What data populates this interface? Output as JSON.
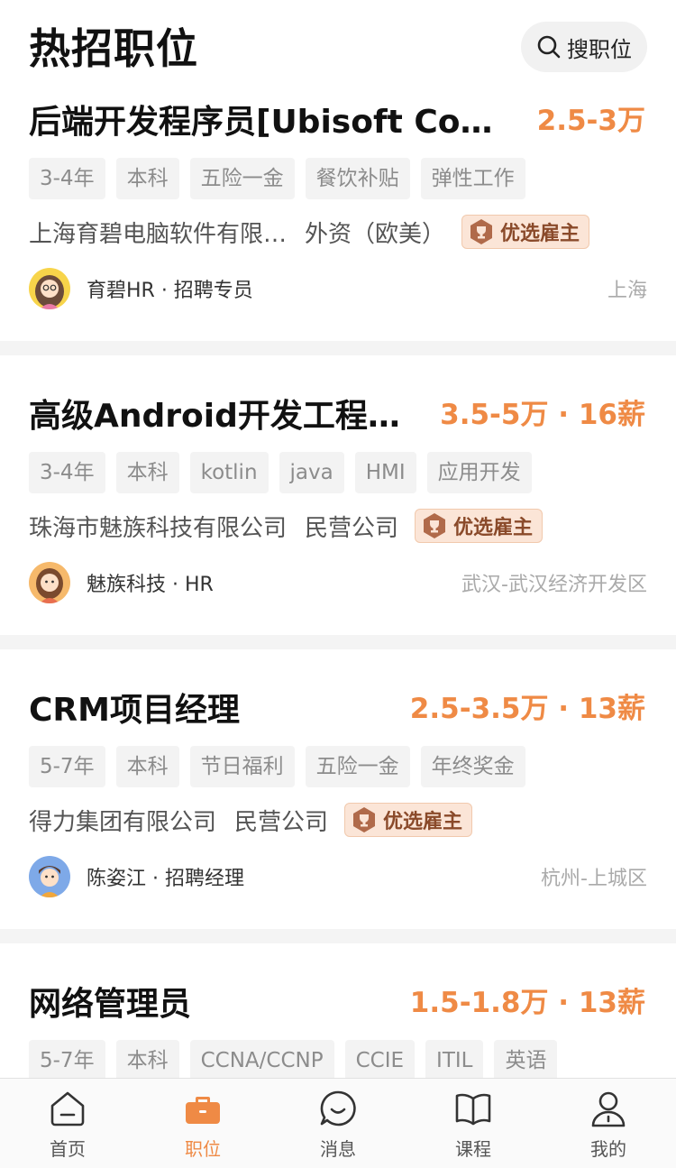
{
  "header": {
    "title": "热招职位",
    "search_label": "搜职位"
  },
  "jobs": [
    {
      "title": "后端开发程序员[Ubisoft Conn…",
      "salary": "2.5-3万",
      "tags": [
        "3-4年",
        "本科",
        "五险一金",
        "餐饮补贴",
        "弹性工作"
      ],
      "company": "上海育碧电脑软件有限…",
      "company_type": "外资（欧美）",
      "badge": "优选雇主",
      "hr": "育碧HR · 招聘专员",
      "location": "上海"
    },
    {
      "title": "高级Android开发工程师…",
      "salary": "3.5-5万 · 16薪",
      "tags": [
        "3-4年",
        "本科",
        "kotlin",
        "java",
        "HMI",
        "应用开发"
      ],
      "company": "珠海市魅族科技有限公司",
      "company_type": "民营公司",
      "badge": "优选雇主",
      "hr": "魅族科技 · HR",
      "location": "武汉-武汉经济开发区"
    },
    {
      "title": "CRM项目经理",
      "salary": "2.5-3.5万 · 13薪",
      "tags": [
        "5-7年",
        "本科",
        "节日福利",
        "五险一金",
        "年终奖金"
      ],
      "company": "得力集团有限公司",
      "company_type": "民营公司",
      "badge": "优选雇主",
      "hr": "陈姿江 · 招聘经理",
      "location": "杭州-上城区"
    },
    {
      "title": "网络管理员",
      "salary": "1.5-1.8万 · 13薪",
      "tags": [
        "5-7年",
        "本科",
        "CCNA/CCNP",
        "CCIE",
        "ITIL",
        "英语"
      ]
    }
  ],
  "tabbar": {
    "items": [
      {
        "label": "首页",
        "icon": "home-icon",
        "active": false
      },
      {
        "label": "职位",
        "icon": "briefcase-icon",
        "active": true
      },
      {
        "label": "消息",
        "icon": "message-icon",
        "active": false
      },
      {
        "label": "课程",
        "icon": "book-icon",
        "active": false
      },
      {
        "label": "我的",
        "icon": "profile-icon",
        "active": false
      }
    ]
  },
  "colors": {
    "accent": "#ef8a45",
    "badge_bg": "#fbe5d7",
    "badge_text": "#8a4a2a",
    "tag_bg": "#f3f3f3"
  }
}
